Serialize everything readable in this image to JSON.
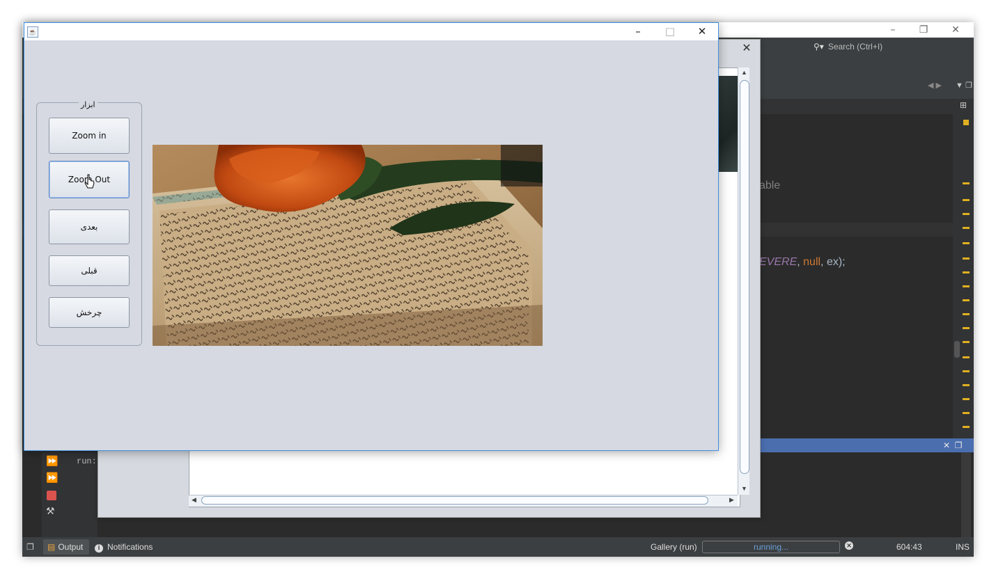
{
  "ide": {
    "search_placeholder": "Search (Ctrl+I)",
    "code_line1": "able",
    "code_line2_part1": "EVERE",
    "code_line2_part2": ", ",
    "code_line2_part3": "null",
    "code_line2_part4": ", ex);",
    "output_run_text": "run:",
    "status": {
      "output_tab": "Output",
      "notifications_tab": "Notifications",
      "task_name": "Gallery (run)",
      "progress_text": "running...",
      "caret_position": "604:43",
      "insert_mode": "INS"
    }
  },
  "viewer": {
    "fieldset_title": "ابزار",
    "buttons": {
      "zoom_in": "Zoom in",
      "zoom_out": "Zoom Out",
      "next": "بعدی",
      "previous": "قبلی",
      "rotate": "چرخش"
    }
  },
  "colors": {
    "ide_bg": "#2b2b2b",
    "window_bg": "#d6d9e1",
    "focus_border": "#3d8ee0",
    "output_header": "#4b6eaf"
  }
}
